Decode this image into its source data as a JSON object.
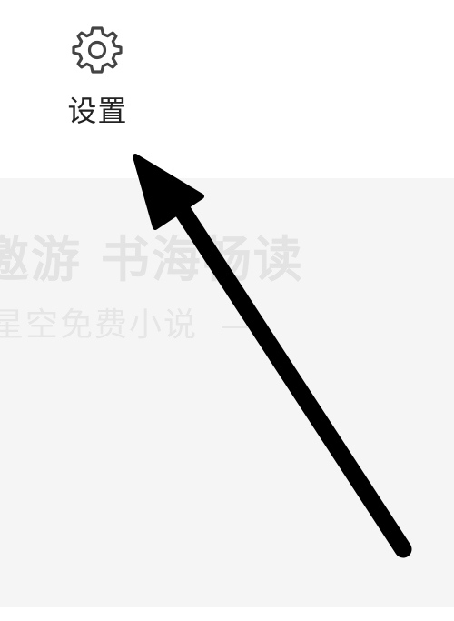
{
  "settings": {
    "icon": "gear-icon",
    "label": "设置"
  },
  "banner": {
    "title": "邀游  书海畅读",
    "subtitle": "星空免费小说"
  },
  "colors": {
    "background": "#ffffff",
    "banner_background": "#f5f5f5",
    "arrow": "#000000",
    "label_text": "#222222"
  }
}
